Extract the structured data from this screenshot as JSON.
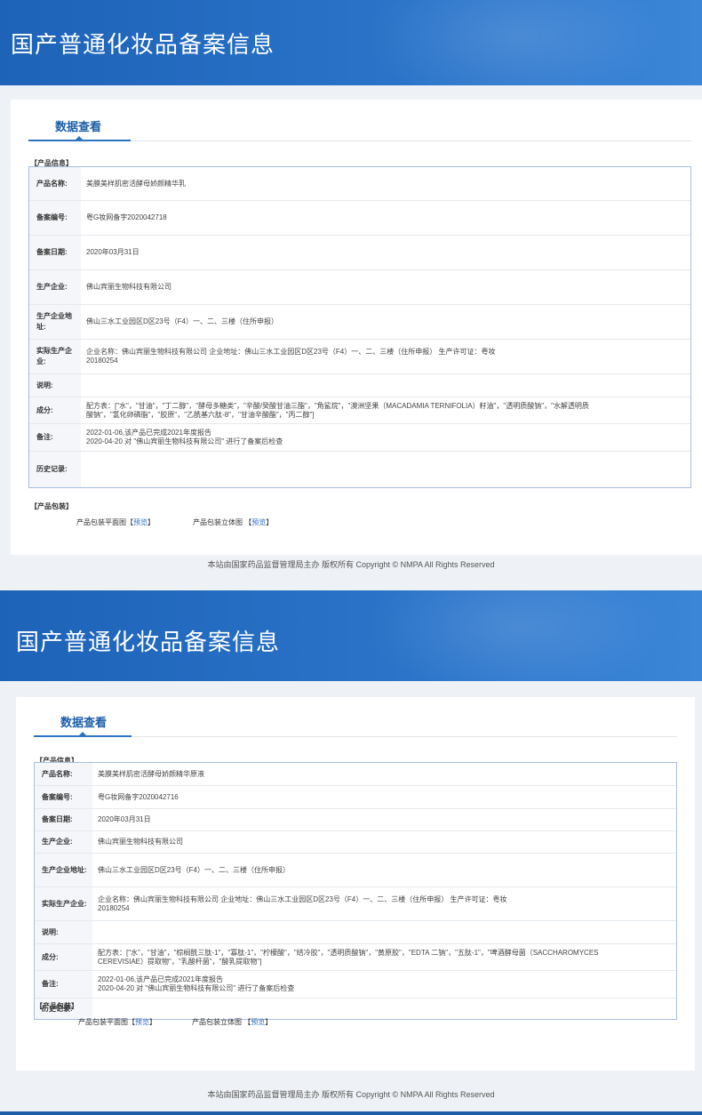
{
  "records": [
    {
      "banner_title": "国产普通化妆品备案信息",
      "tab_label": "数据查看",
      "section_info": "【产品信息】",
      "rows": [
        {
          "label": "产品名称:",
          "value": "美膜美样肌密活酵母娇颜精华乳"
        },
        {
          "label": "备案编号:",
          "value": "粤G妆网备字2020042718"
        },
        {
          "label": "备案日期:",
          "value": "2020年03月31日"
        },
        {
          "label": "生产企业:",
          "value": "佛山宾丽生物科技有限公司"
        },
        {
          "label": "生产企业地址:",
          "value": "佛山三水工业园区D区23号（F4）一、二、三楼（住所申报）"
        },
        {
          "label": "实际生产企业:",
          "value": "企业名称：佛山宾丽生物科技有限公司 企业地址：佛山三水工业园区D区23号（F4）一、二、三楼（住所申报） 生产许可证：粤妆\n20180254"
        },
        {
          "label": "说明:",
          "value": ""
        },
        {
          "label": "成分:",
          "value": "配方表：[\"水\"，\"甘油\"，\"丁二醇\"，\"酵母多糖类\"，\"辛酸/癸酸甘油三酯\"，\"角鲨烷\"，\"澳洲坚果（MACADAMIA TERNIFOLIA）籽油\"，\"透明质酸钠\"，\"水解透明质\n酸钠\"，\"氢化卵磷脂\"，\"胶原\"，\"乙酰基六肽-8\"，\"甘油辛酸酯\"，\"丙二醇\"]"
        },
        {
          "label": "备注:",
          "value": "2022-01-06,该产品已完成2021年度报告\n2020-04-20 对 \"佛山宾丽生物科技有限公司\" 进行了备案后检查"
        },
        {
          "label": "历史记录:",
          "value": ""
        }
      ],
      "section_pack": "【产品包装】",
      "pack_flat_label": "产品包装平面图",
      "pack_3d_label": "产品包装立体图",
      "preview_label": "预览",
      "footer": "本站由国家药品监督管理局主办 版权所有 Copyright © NMPA All Rights Reserved"
    },
    {
      "banner_title": "国产普通化妆品备案信息",
      "tab_label": "数据查看",
      "section_info": "【产品信息】",
      "rows": [
        {
          "label": "产品名称:",
          "value": "美膜美样肌密活酵母娇颜精华原液"
        },
        {
          "label": "备案编号:",
          "value": "粤G妆网备字2020042716"
        },
        {
          "label": "备案日期:",
          "value": "2020年03月31日"
        },
        {
          "label": "生产企业:",
          "value": "佛山宾丽生物科技有限公司"
        },
        {
          "label": "生产企业地址:",
          "value": "佛山三水工业园区D区23号（F4）一、二、三楼（住所申报）"
        },
        {
          "label": "实际生产企业:",
          "value": "企业名称：佛山宾丽生物科技有限公司 企业地址：佛山三水工业园区D区23号（F4）一、二、三楼（住所申报） 生产许可证：粤妆\n20180254"
        },
        {
          "label": "说明:",
          "value": ""
        },
        {
          "label": "成分:",
          "value": "配方表：[\"水\"，\"甘油\"，\"棕榈酰三肽-1\"，\"寡肽-1\"，\"柠檬酸\"，\"结冷胶\"，\"透明质酸钠\"，\"黄原胶\"，\"EDTA 二钠\"，\"五肽-1\"，\"啤酒酵母菌（SACCHAROMYCES\nCEREVISIAE）提取物\"，\"乳酸杆菌\"，\"酸乳提取物\"]"
        },
        {
          "label": "备注:",
          "value": "2022-01-06,该产品已完成2021年度报告\n2020-04-20 对 \"佛山宾丽生物科技有限公司\" 进行了备案后检查"
        },
        {
          "label": "历史记录:",
          "value": ""
        }
      ],
      "section_pack": "【产品包装】",
      "pack_flat_label": "产品包装平面图",
      "pack_3d_label": "产品包装立体图",
      "preview_label": "预览",
      "footer": "本站由国家药品监督管理局主办 版权所有 Copyright © NMPA All Rights Reserved"
    }
  ]
}
